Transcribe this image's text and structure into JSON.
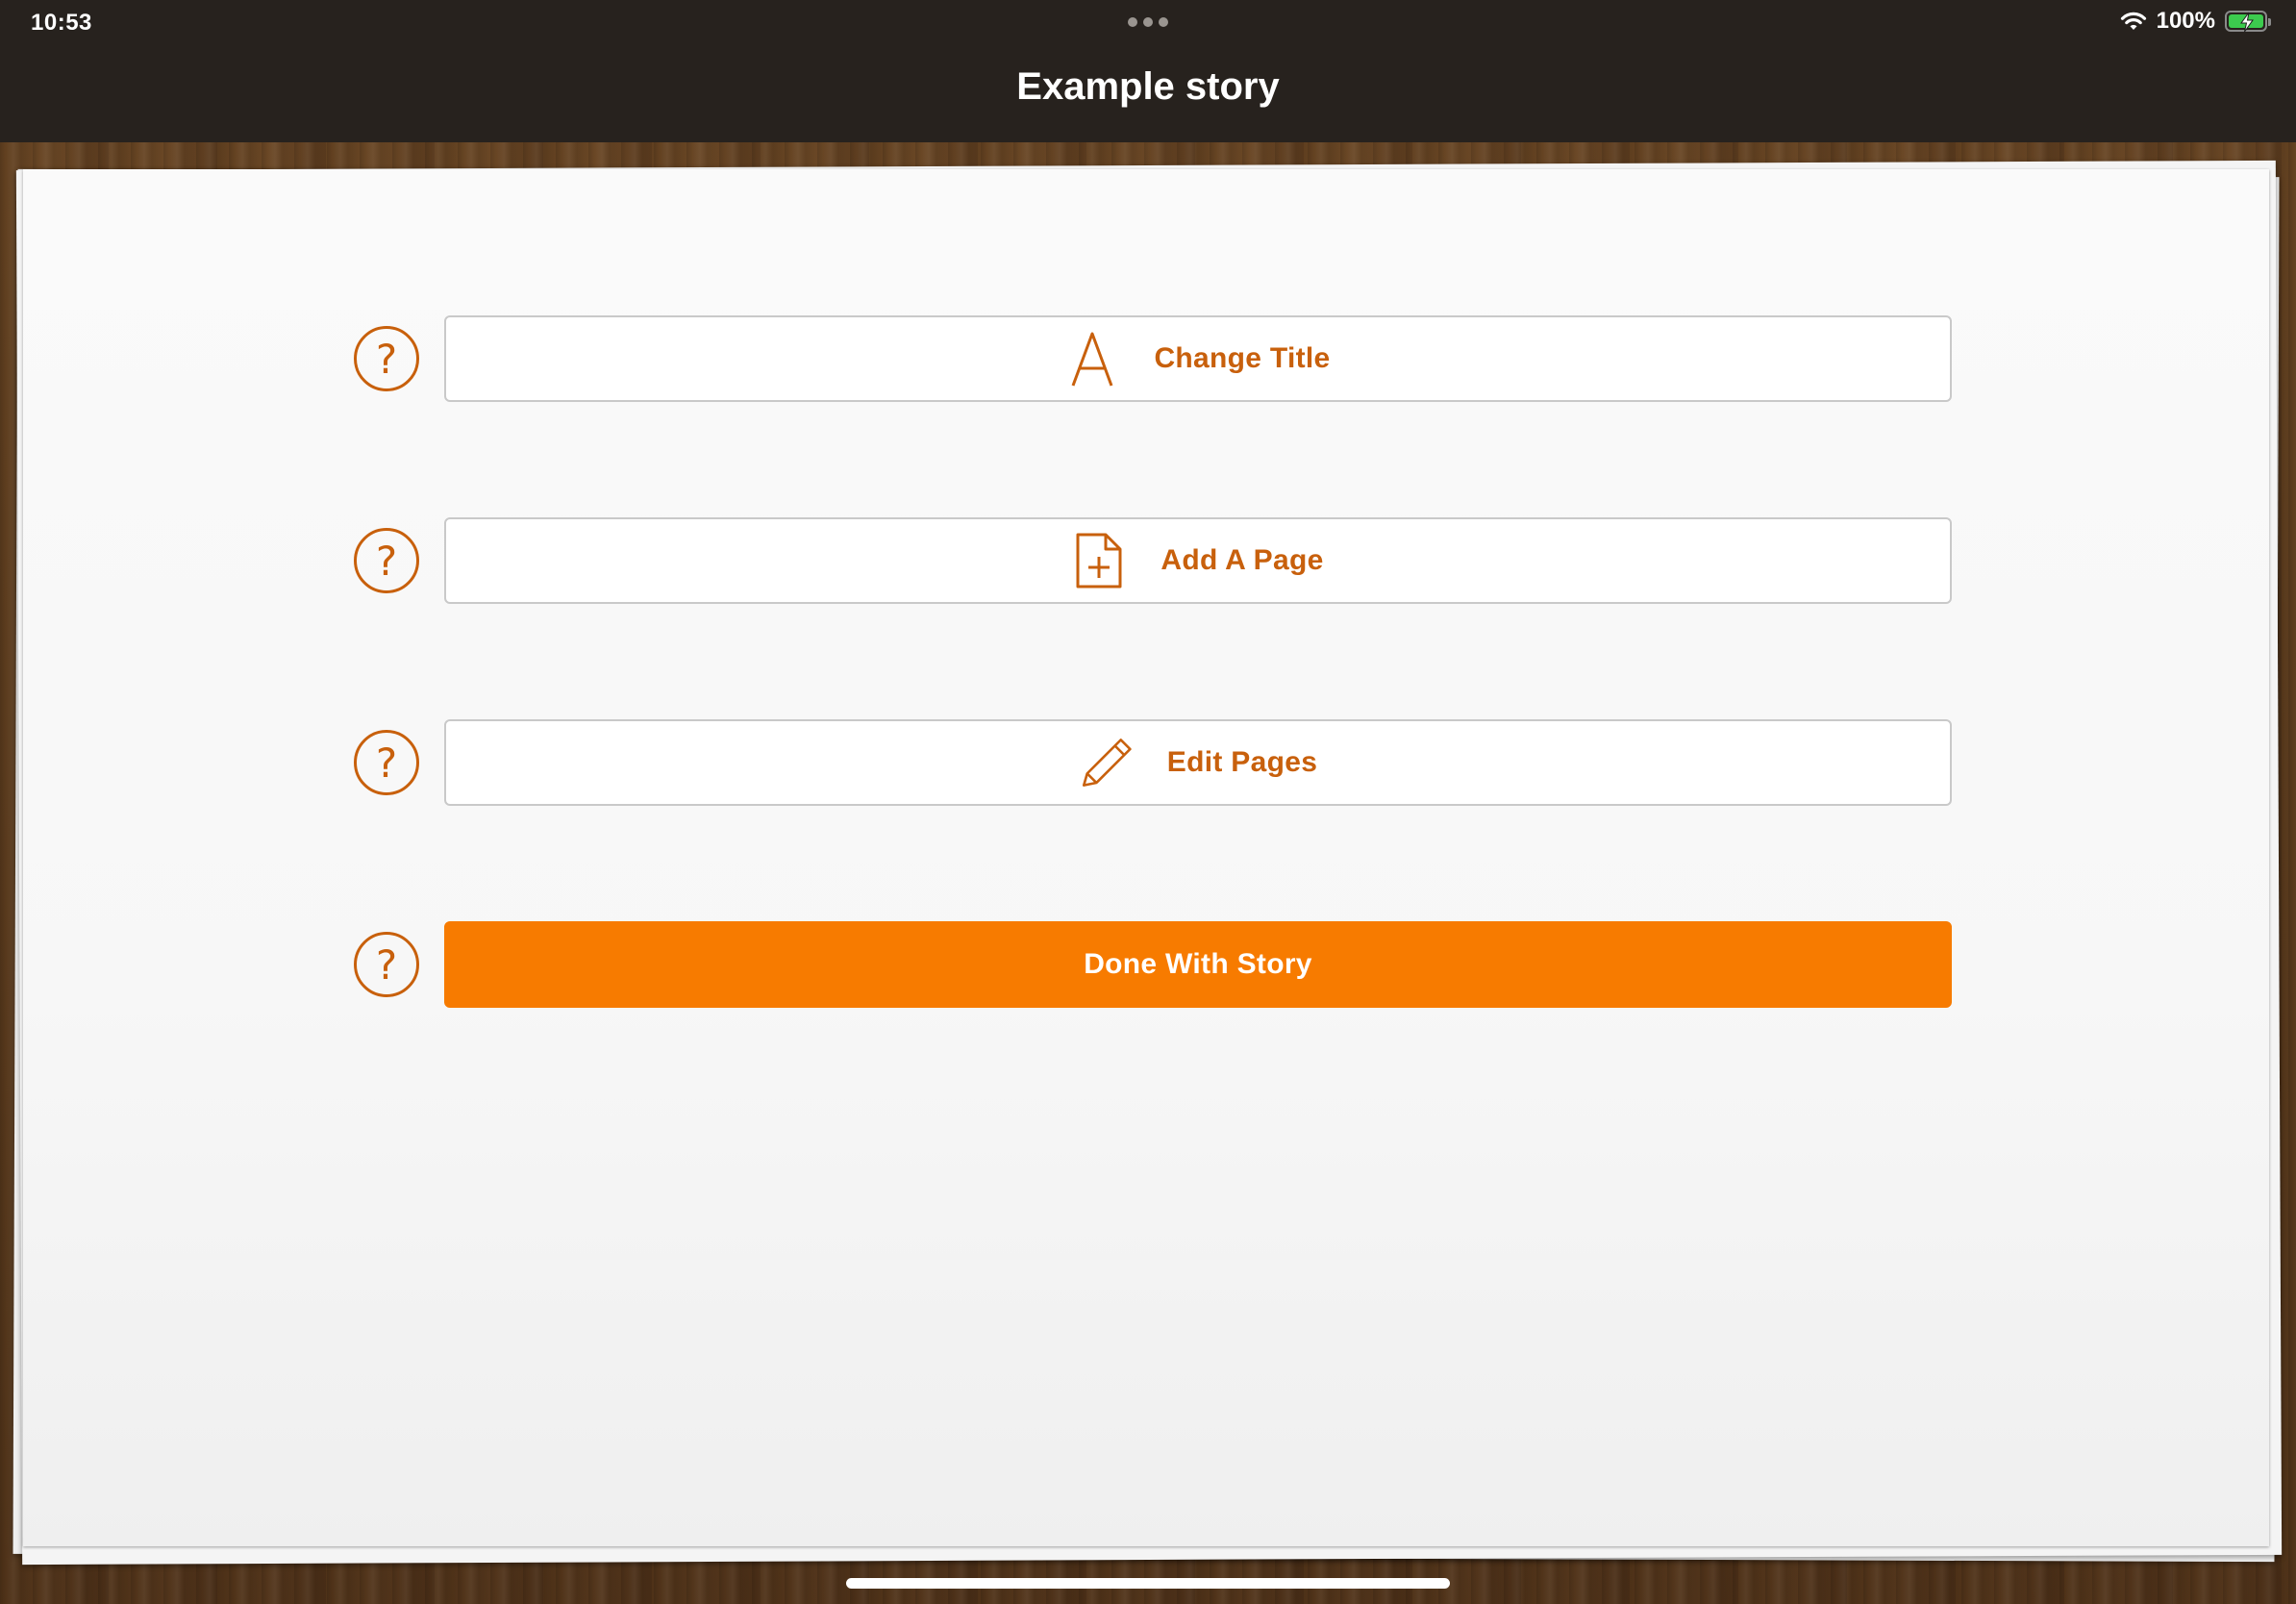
{
  "status_bar": {
    "time": "10:53",
    "battery_percent": "100%",
    "battery_level": 1.0,
    "battery_color": "#3ccb4e"
  },
  "nav": {
    "title": "Example story"
  },
  "help": {
    "glyph": "?"
  },
  "actions": [
    {
      "label": "Change Title",
      "icon": "letter-a-icon"
    },
    {
      "label": "Add A Page",
      "icon": "add-page-icon"
    },
    {
      "label": "Edit Pages",
      "icon": "pencil-icon"
    },
    {
      "label": "Done With Story",
      "icon": ""
    }
  ],
  "colors": {
    "accent": "#c8600c",
    "primary_button": "#f77b00",
    "top_bar": "#27221e"
  }
}
